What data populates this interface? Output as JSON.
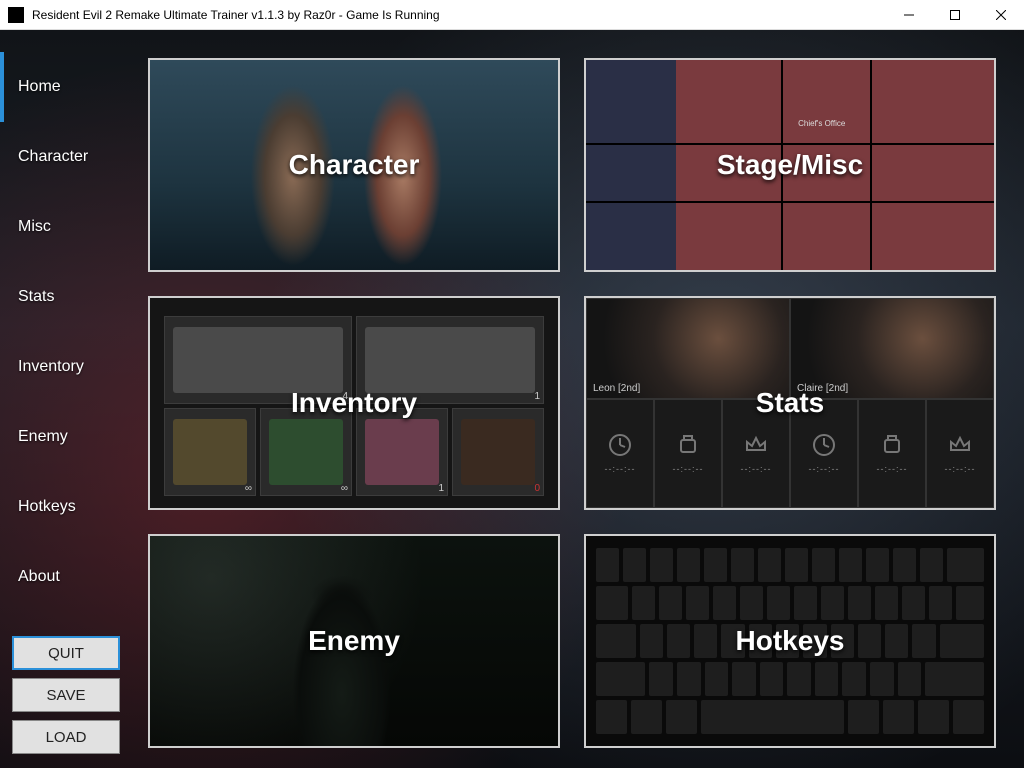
{
  "window": {
    "title": "Resident Evil 2 Remake Ultimate Trainer v1.1.3 by Raz0r - Game Is Running"
  },
  "sidebar": {
    "items": [
      {
        "label": "Home",
        "active": true
      },
      {
        "label": "Character",
        "active": false
      },
      {
        "label": "Misc",
        "active": false
      },
      {
        "label": "Stats",
        "active": false
      },
      {
        "label": "Inventory",
        "active": false
      },
      {
        "label": "Enemy",
        "active": false
      },
      {
        "label": "Hotkeys",
        "active": false
      },
      {
        "label": "About",
        "active": false
      }
    ],
    "buttons": {
      "quit": "QUIT",
      "save": "SAVE",
      "load": "LOAD"
    }
  },
  "tiles": {
    "character": "Character",
    "stage": "Stage/Misc",
    "inventory": "Inventory",
    "stats": "Stats",
    "enemy": "Enemy",
    "hotkeys": "Hotkeys"
  },
  "stats_tile": {
    "portrait_left": "Leon [2nd]",
    "portrait_right": "Claire [2nd]",
    "dash_value": "--:--:--"
  },
  "inventory_tile": {
    "slots": [
      {
        "wide": true,
        "qty": "4",
        "color": "#4a4a4a"
      },
      {
        "wide": true,
        "qty": "1",
        "color": "#4a4a4a"
      },
      {
        "wide": false,
        "qty": "∞",
        "color": "#53492d"
      },
      {
        "wide": false,
        "qty": "∞",
        "color": "#2d4d2f"
      },
      {
        "wide": false,
        "qty": "1",
        "color": "#6a3d4d"
      },
      {
        "wide": false,
        "qty": "0",
        "color": "#3a2a20",
        "red": true
      }
    ]
  }
}
